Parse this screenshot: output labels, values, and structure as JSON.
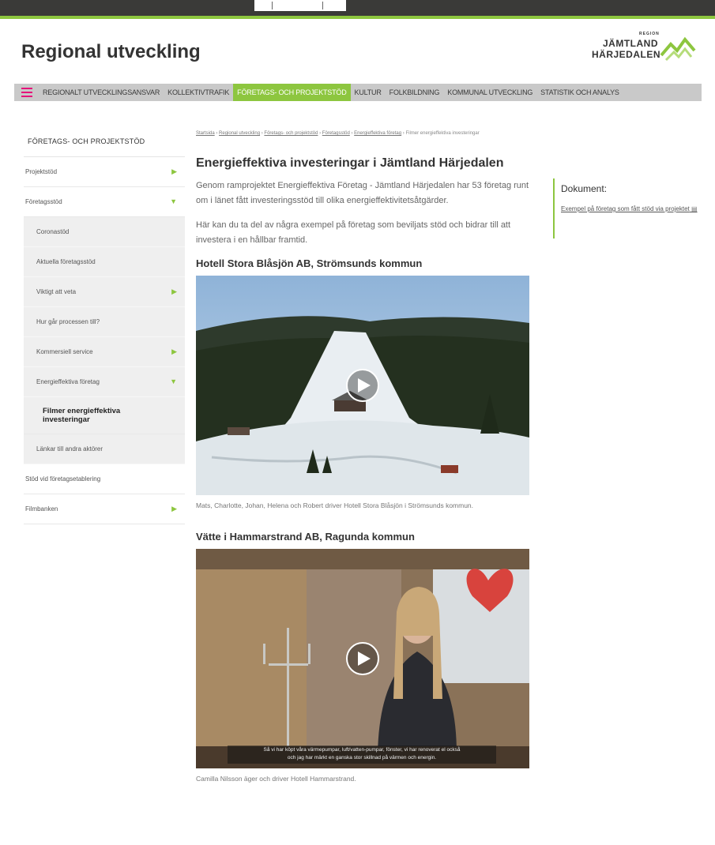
{
  "header": {
    "site_title": "Regional utveckling",
    "logo": {
      "region": "REGION",
      "line1": "JÄMTLAND",
      "line2": "HÄRJEDALEN"
    }
  },
  "nav": {
    "items": [
      {
        "label": "REGIONALT UTVECKLINGSANSVAR",
        "active": false
      },
      {
        "label": "KOLLEKTIVTRAFIK",
        "active": false
      },
      {
        "label": "FÖRETAGS- OCH PROJEKTSTÖD",
        "active": true
      },
      {
        "label": "KULTUR",
        "active": false
      },
      {
        "label": "FOLKBILDNING",
        "active": false
      },
      {
        "label": "KOMMUNAL UTVECKLING",
        "active": false
      },
      {
        "label": "STATISTIK OCH ANALYS",
        "active": false
      }
    ]
  },
  "sidebar": {
    "heading": "FÖRETAGS- OCH PROJEKTSTÖD",
    "items": [
      {
        "label": "Projektstöd",
        "arrow": "right"
      },
      {
        "label": "Företagsstöd",
        "arrow": "down"
      },
      {
        "label": "Coronastöd",
        "arrow": "",
        "level": 1
      },
      {
        "label": "Aktuella företagsstöd",
        "arrow": "",
        "level": 1
      },
      {
        "label": "Viktigt att veta",
        "arrow": "right",
        "level": 1
      },
      {
        "label": "Hur går processen till?",
        "arrow": "",
        "level": 1
      },
      {
        "label": "Kommersiell service",
        "arrow": "right",
        "level": 1
      },
      {
        "label": "Energieffektiva företag",
        "arrow": "down",
        "level": 1
      },
      {
        "label": "Filmer energieffektiva investeringar",
        "arrow": "",
        "level": 2
      },
      {
        "label": "Länkar till andra aktörer",
        "arrow": "",
        "level": 1
      },
      {
        "label": "Stöd vid företagsetablering",
        "arrow": ""
      },
      {
        "label": "Filmbanken",
        "arrow": "right"
      }
    ]
  },
  "breadcrumb": {
    "links": [
      "Startsida",
      "Regional utveckling",
      "Företags- och projektstöd",
      "Företagsstöd",
      "Energieffektiva företag"
    ],
    "current": "Filmer energieffektiva investeringar"
  },
  "main": {
    "title": "Energieffektiva investeringar i Jämtland Härjedalen",
    "intro1": "Genom ramprojektet Energieffektiva Företag - Jämtland Härjedalen har 53 företag runt om i länet fått investeringsstöd till olika energieffektivitetsåtgärder.",
    "intro2": "Här kan du ta del av några exempel på företag som beviljats stöd och bidrar till att investera i en hållbar framtid.",
    "videos": [
      {
        "heading": "Hotell Stora Blåsjön AB, Strömsunds kommun",
        "caption": "Mats, Charlotte, Johan, Helena och Robert driver Hotell Stora Blåsjön i Strömsunds kommun."
      },
      {
        "heading": "Vätte i Hammarstrand AB, Ragunda kommun",
        "subtitle_line1": "Så vi har köpt våra värmepumpar, luft/vatten-pumpar, fönster, vi har renoverat el också",
        "subtitle_line2": "och jag har märkt en ganska stor skillnad på värmen och energin.",
        "caption": "Camilla Nilsson äger och driver Hotell Hammarstrand."
      }
    ]
  },
  "documents": {
    "heading": "Dokument:",
    "link": "Exempel på företag som fått stöd via projektet"
  },
  "colors": {
    "accent": "#8dc63f",
    "menu_icon": "#e5147b"
  },
  "icons": [
    "menu-icon",
    "play-icon",
    "arrow-right-icon",
    "arrow-down-icon",
    "pdf-icon"
  ]
}
